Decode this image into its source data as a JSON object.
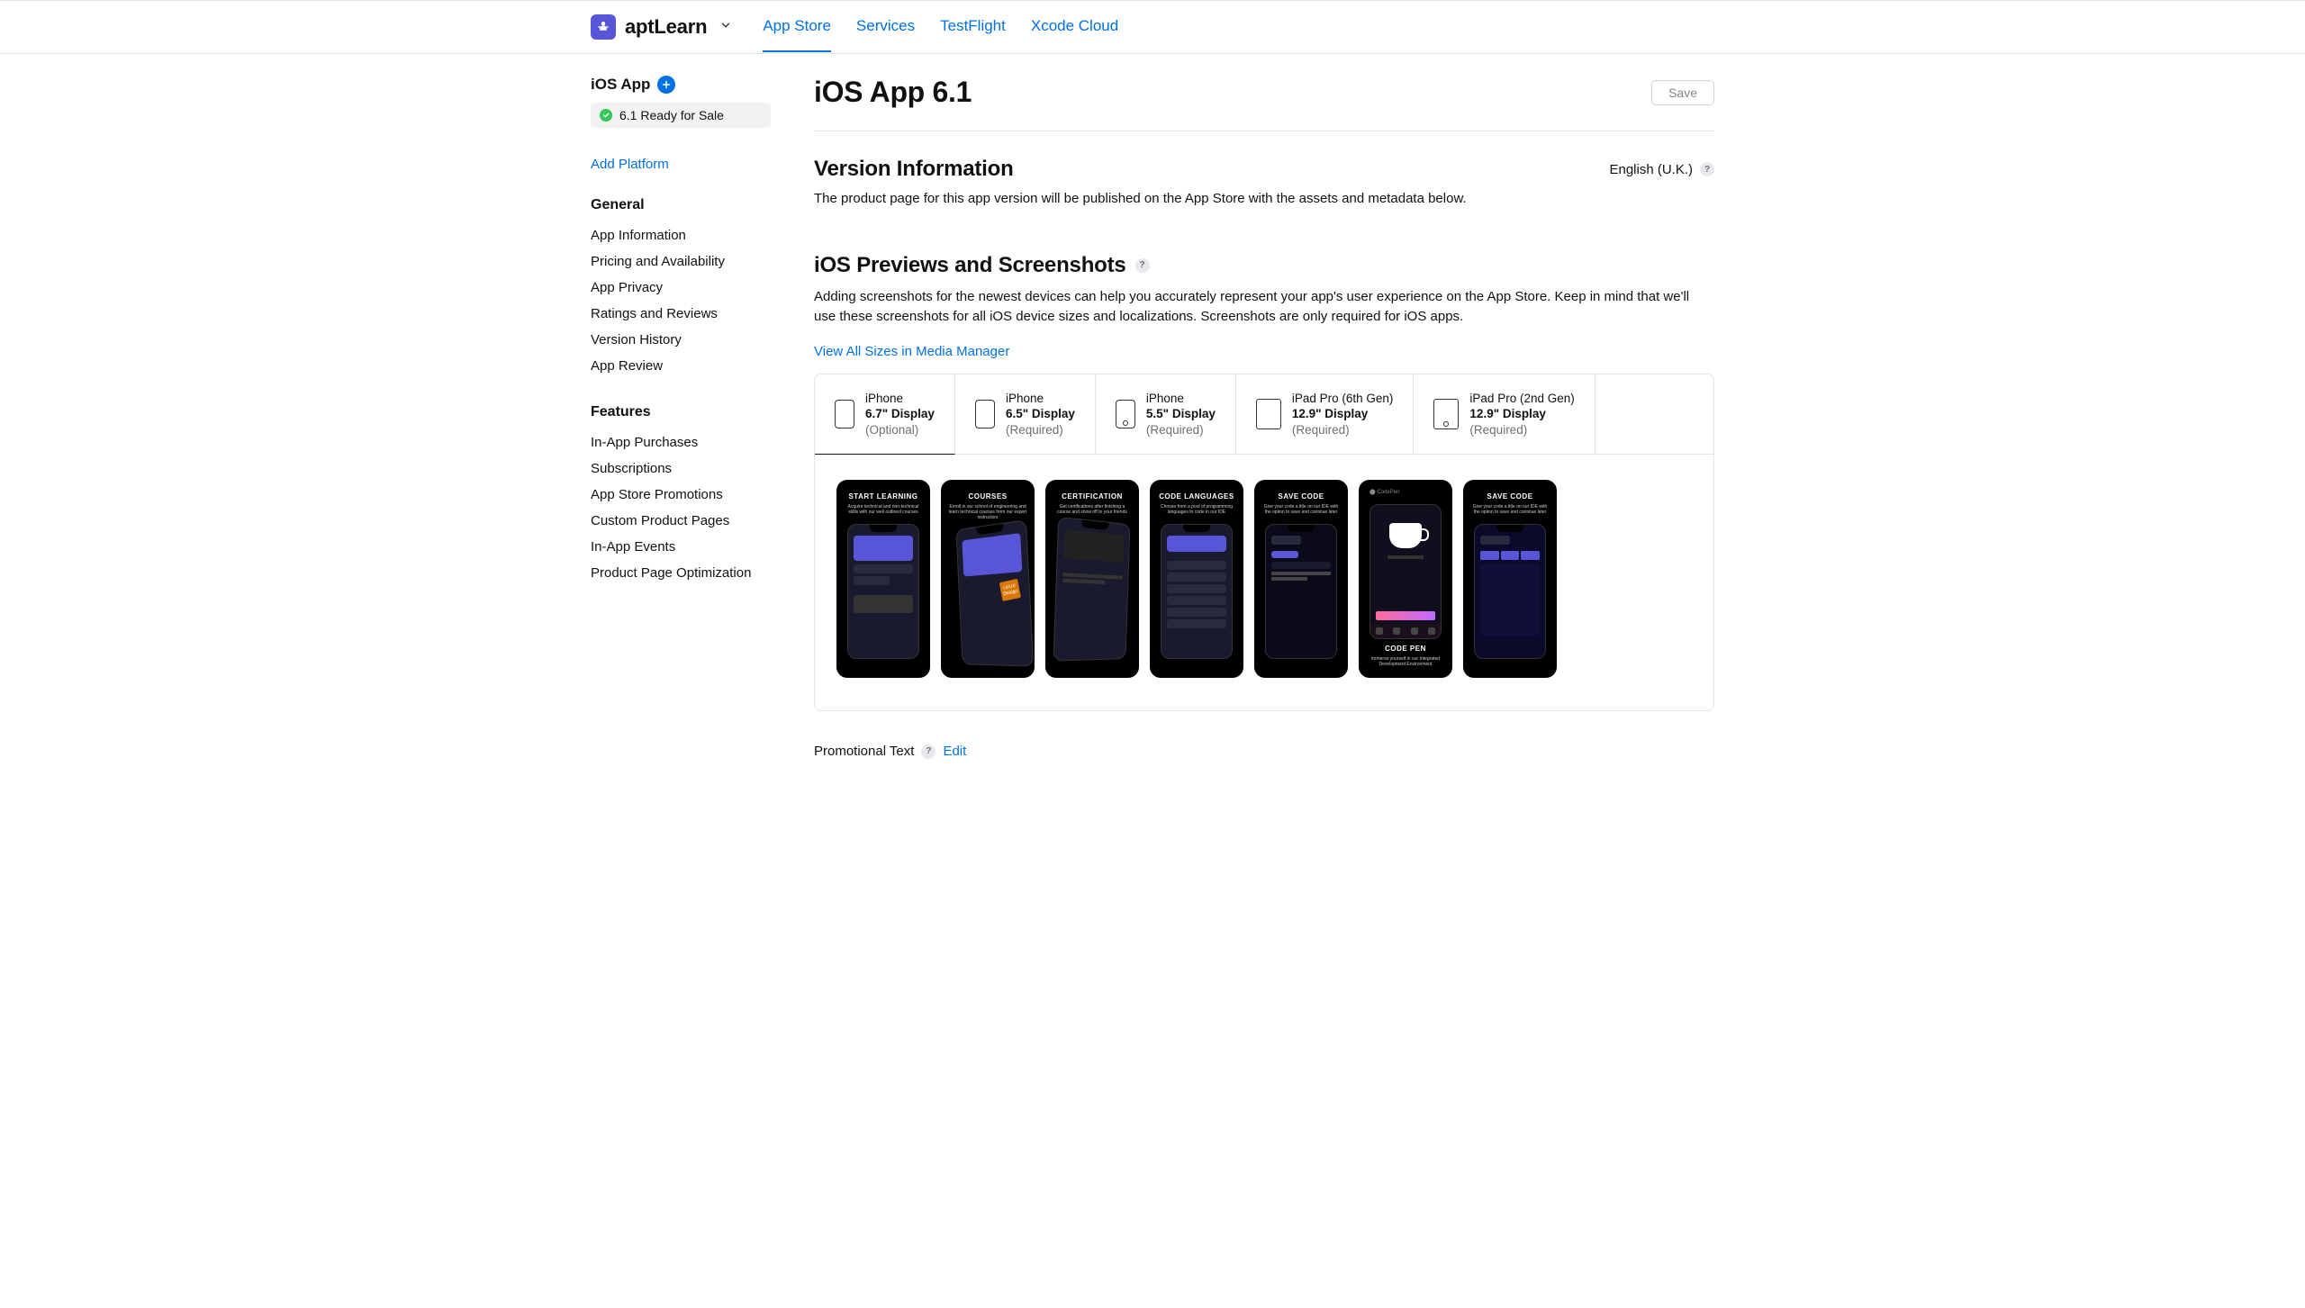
{
  "header": {
    "app_name": "aptLearn",
    "tabs": [
      "App Store",
      "Services",
      "TestFlight",
      "Xcode Cloud"
    ]
  },
  "sidebar": {
    "platform_label": "iOS App",
    "status_text": "6.1 Ready for Sale",
    "add_platform": "Add Platform",
    "groups": [
      {
        "title": "General",
        "items": [
          "App Information",
          "Pricing and Availability",
          "App Privacy",
          "Ratings and Reviews",
          "Version History",
          "App Review"
        ]
      },
      {
        "title": "Features",
        "items": [
          "In-App Purchases",
          "Subscriptions",
          "App Store Promotions",
          "Custom Product Pages",
          "In-App Events",
          "Product Page Optimization"
        ]
      }
    ]
  },
  "main": {
    "title": "iOS App 6.1",
    "save": "Save",
    "version_info": {
      "heading": "Version Information",
      "language": "English (U.K.)",
      "description": "The product page for this app version will be published on the App Store with the assets and metadata below."
    },
    "previews": {
      "heading": "iOS Previews and Screenshots",
      "description": "Adding screenshots for the newest devices can help you accurately represent your app's user experience on the App Store. Keep in mind that we'll use these screenshots for all iOS device sizes and localizations. Screenshots are only required for iOS apps.",
      "media_link": "View All Sizes in Media Manager",
      "devices": [
        {
          "name": "iPhone",
          "size": "6.7\" Display",
          "req": "(Optional)"
        },
        {
          "name": "iPhone",
          "size": "6.5\" Display",
          "req": "(Required)"
        },
        {
          "name": "iPhone",
          "size": "5.5\" Display",
          "req": "(Required)"
        },
        {
          "name": "iPad Pro (6th Gen)",
          "size": "12.9\" Display",
          "req": "(Required)"
        },
        {
          "name": "iPad Pro (2nd Gen)",
          "size": "12.9\" Display",
          "req": "(Required)"
        }
      ],
      "shots": [
        {
          "title": "START LEARNING",
          "sub": "Acquire technical and non-technical skills with our well outlined courses"
        },
        {
          "title": "COURSES",
          "sub": "Enroll in our school of engineering and learn technical courses from our expert instructors"
        },
        {
          "title": "CERTIFICATION",
          "sub": "Get certifications after finishing a course and show off to your friends"
        },
        {
          "title": "CODE LANGUAGES",
          "sub": "Choose from a pool of programming languages to code in our IDE"
        },
        {
          "title": "SAVE CODE",
          "sub": "Give your code a title on our IDE with the option to save and continue later"
        },
        {
          "title": "",
          "sub": ""
        },
        {
          "title": "CODE PEN",
          "sub": "Immerse yourself in our Integrated Development Environment"
        },
        {
          "title": "SAVE CODE",
          "sub": "Give your code a title on our IDE with the option to save and continue later"
        }
      ]
    },
    "promo": {
      "label": "Promotional Text",
      "edit": "Edit"
    }
  }
}
